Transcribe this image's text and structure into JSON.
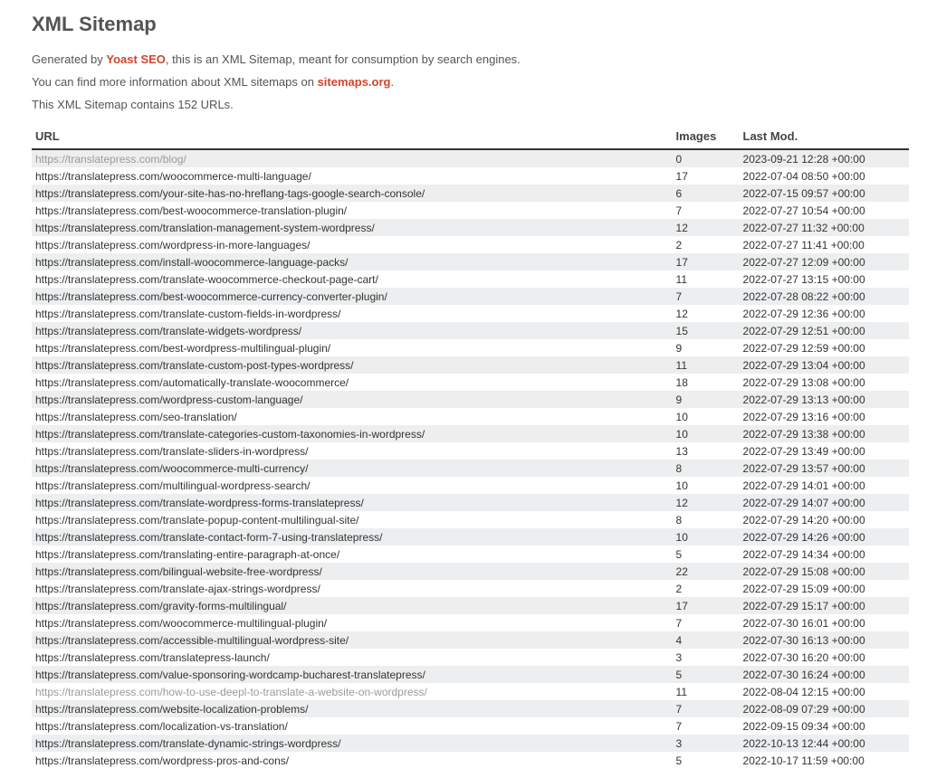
{
  "title": "XML Sitemap",
  "intro": {
    "generated_prefix": "Generated by ",
    "generated_brand": "Yoast SEO",
    "generated_suffix": ", this is an XML Sitemap, meant for consumption by search engines.",
    "more_prefix": "You can find more information about XML sitemaps on ",
    "more_link": "sitemaps.org",
    "more_suffix": ".",
    "count_line": "This XML Sitemap contains 152 URLs."
  },
  "columns": {
    "url": "URL",
    "images": "Images",
    "lastmod": "Last Mod."
  },
  "rows": [
    {
      "url": "https://translatepress.com/blog/",
      "images": "0",
      "lastmod": "2023-09-21 12:28 +00:00",
      "muted": true
    },
    {
      "url": "https://translatepress.com/woocommerce-multi-language/",
      "images": "17",
      "lastmod": "2022-07-04 08:50 +00:00"
    },
    {
      "url": "https://translatepress.com/your-site-has-no-hreflang-tags-google-search-console/",
      "images": "6",
      "lastmod": "2022-07-15 09:57 +00:00"
    },
    {
      "url": "https://translatepress.com/best-woocommerce-translation-plugin/",
      "images": "7",
      "lastmod": "2022-07-27 10:54 +00:00"
    },
    {
      "url": "https://translatepress.com/translation-management-system-wordpress/",
      "images": "12",
      "lastmod": "2022-07-27 11:32 +00:00"
    },
    {
      "url": "https://translatepress.com/wordpress-in-more-languages/",
      "images": "2",
      "lastmod": "2022-07-27 11:41 +00:00"
    },
    {
      "url": "https://translatepress.com/install-woocommerce-language-packs/",
      "images": "17",
      "lastmod": "2022-07-27 12:09 +00:00"
    },
    {
      "url": "https://translatepress.com/translate-woocommerce-checkout-page-cart/",
      "images": "11",
      "lastmod": "2022-07-27 13:15 +00:00"
    },
    {
      "url": "https://translatepress.com/best-woocommerce-currency-converter-plugin/",
      "images": "7",
      "lastmod": "2022-07-28 08:22 +00:00"
    },
    {
      "url": "https://translatepress.com/translate-custom-fields-in-wordpress/",
      "images": "12",
      "lastmod": "2022-07-29 12:36 +00:00"
    },
    {
      "url": "https://translatepress.com/translate-widgets-wordpress/",
      "images": "15",
      "lastmod": "2022-07-29 12:51 +00:00"
    },
    {
      "url": "https://translatepress.com/best-wordpress-multilingual-plugin/",
      "images": "9",
      "lastmod": "2022-07-29 12:59 +00:00"
    },
    {
      "url": "https://translatepress.com/translate-custom-post-types-wordpress/",
      "images": "11",
      "lastmod": "2022-07-29 13:04 +00:00"
    },
    {
      "url": "https://translatepress.com/automatically-translate-woocommerce/",
      "images": "18",
      "lastmod": "2022-07-29 13:08 +00:00"
    },
    {
      "url": "https://translatepress.com/wordpress-custom-language/",
      "images": "9",
      "lastmod": "2022-07-29 13:13 +00:00"
    },
    {
      "url": "https://translatepress.com/seo-translation/",
      "images": "10",
      "lastmod": "2022-07-29 13:16 +00:00"
    },
    {
      "url": "https://translatepress.com/translate-categories-custom-taxonomies-in-wordpress/",
      "images": "10",
      "lastmod": "2022-07-29 13:38 +00:00"
    },
    {
      "url": "https://translatepress.com/translate-sliders-in-wordpress/",
      "images": "13",
      "lastmod": "2022-07-29 13:49 +00:00"
    },
    {
      "url": "https://translatepress.com/woocommerce-multi-currency/",
      "images": "8",
      "lastmod": "2022-07-29 13:57 +00:00"
    },
    {
      "url": "https://translatepress.com/multilingual-wordpress-search/",
      "images": "10",
      "lastmod": "2022-07-29 14:01 +00:00"
    },
    {
      "url": "https://translatepress.com/translate-wordpress-forms-translatepress/",
      "images": "12",
      "lastmod": "2022-07-29 14:07 +00:00"
    },
    {
      "url": "https://translatepress.com/translate-popup-content-multilingual-site/",
      "images": "8",
      "lastmod": "2022-07-29 14:20 +00:00"
    },
    {
      "url": "https://translatepress.com/translate-contact-form-7-using-translatepress/",
      "images": "10",
      "lastmod": "2022-07-29 14:26 +00:00"
    },
    {
      "url": "https://translatepress.com/translating-entire-paragraph-at-once/",
      "images": "5",
      "lastmod": "2022-07-29 14:34 +00:00"
    },
    {
      "url": "https://translatepress.com/bilingual-website-free-wordpress/",
      "images": "22",
      "lastmod": "2022-07-29 15:08 +00:00"
    },
    {
      "url": "https://translatepress.com/translate-ajax-strings-wordpress/",
      "images": "2",
      "lastmod": "2022-07-29 15:09 +00:00"
    },
    {
      "url": "https://translatepress.com/gravity-forms-multilingual/",
      "images": "17",
      "lastmod": "2022-07-29 15:17 +00:00"
    },
    {
      "url": "https://translatepress.com/woocommerce-multilingual-plugin/",
      "images": "7",
      "lastmod": "2022-07-30 16:01 +00:00"
    },
    {
      "url": "https://translatepress.com/accessible-multilingual-wordpress-site/",
      "images": "4",
      "lastmod": "2022-07-30 16:13 +00:00"
    },
    {
      "url": "https://translatepress.com/translatepress-launch/",
      "images": "3",
      "lastmod": "2022-07-30 16:20 +00:00"
    },
    {
      "url": "https://translatepress.com/value-sponsoring-wordcamp-bucharest-translatepress/",
      "images": "5",
      "lastmod": "2022-07-30 16:24 +00:00"
    },
    {
      "url": "https://translatepress.com/how-to-use-deepl-to-translate-a-website-on-wordpress/",
      "images": "11",
      "lastmod": "2022-08-04 12:15 +00:00",
      "muted": true
    },
    {
      "url": "https://translatepress.com/website-localization-problems/",
      "images": "7",
      "lastmod": "2022-08-09 07:29 +00:00"
    },
    {
      "url": "https://translatepress.com/localization-vs-translation/",
      "images": "7",
      "lastmod": "2022-09-15 09:34 +00:00"
    },
    {
      "url": "https://translatepress.com/translate-dynamic-strings-wordpress/",
      "images": "3",
      "lastmod": "2022-10-13 12:44 +00:00"
    },
    {
      "url": "https://translatepress.com/wordpress-pros-and-cons/",
      "images": "5",
      "lastmod": "2022-10-17 11:59 +00:00"
    }
  ]
}
